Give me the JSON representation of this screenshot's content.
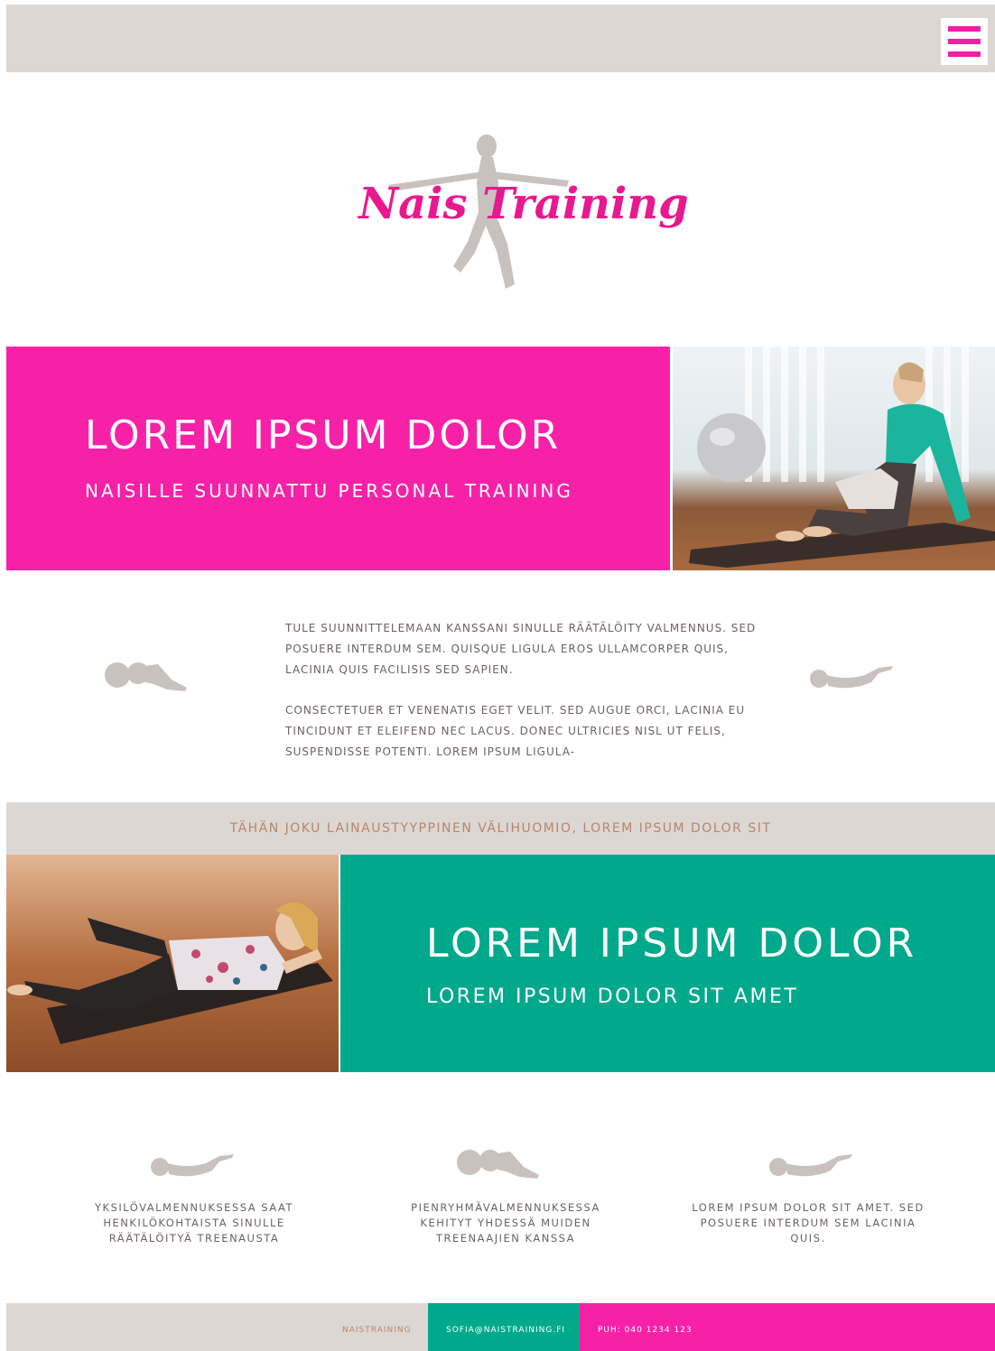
{
  "colors": {
    "pink": "#f721a7",
    "teal": "#00a98b",
    "beige": "#dcd7d3",
    "copper": "#b7876a",
    "text": "#6b6262"
  },
  "header": {
    "menu_icon": "hamburger-menu-icon"
  },
  "logo": {
    "text": "Nais Training"
  },
  "hero_primary": {
    "title": "LOREM IPSUM DOLOR",
    "subtitle": "NAISILLE SUUNNATTU PERSONAL TRAINING"
  },
  "intro": {
    "paragraphs": [
      "TULE SUUNNITTELEMAAN KANSSANI SINULLE RÄÄTÄLÖITY VALMENNUS. SED POSUERE INTERDUM SEM. QUISQUE LIGULA EROS ULLAMCORPER QUIS, LACINIA QUIS FACILISIS SED SAPIEN.",
      "CONSECTETUER ET VENENATIS EGET VELIT. SED AUGUE ORCI, LACINIA EU TINCIDUNT ET ELEIFEND  NEC LACUS. DONEC ULTRICIES NISL UT FELIS, SUSPENDISSE POTENTI. LOREM IPSUM LIGULA-"
    ]
  },
  "quote": {
    "text": "TÄHÄN JOKU LAINAUSTYYPPINEN VÄLIHUOMIO, LOREM IPSUM DOLOR SIT"
  },
  "hero_secondary": {
    "title": "LOREM IPSUM DOLOR",
    "subtitle": "LOREM IPSUM DOLOR SIT AMET"
  },
  "features": [
    {
      "icon": "curled-figure-icon",
      "text": "YKSILÖVALMENNUKSESSA SAAT HENKILÖKOHTAISTA SINULLE RÄÄTÄLÖITYÄ TREENAUSTA"
    },
    {
      "icon": "kneeling-figure-icon",
      "text": "PIENRYHMÄVALMENNUKSESSA KEHITYT YHDESSÄ MUIDEN TREENAAJIEN KANSSA"
    },
    {
      "icon": "curled-figure-icon",
      "text": "LOREM IPSUM DOLOR SIT AMET. SED POSUERE INTERDUM SEM LACINIA QUIS."
    }
  ],
  "footer": {
    "brand": "NAISTRAINING",
    "email": "SOFIA@NAISTRAINING.FI",
    "phone": "PUH: 040 1234 123"
  }
}
